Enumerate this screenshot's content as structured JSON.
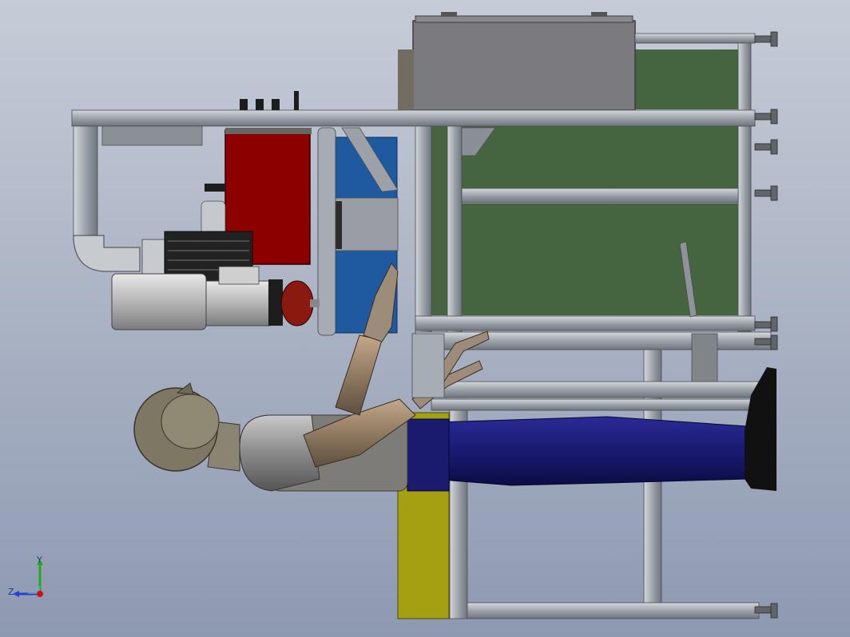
{
  "viewport": {
    "background_top": "#c6ccd7",
    "background_bottom": "#8e99b1"
  },
  "triad": {
    "x_label": "",
    "y_label": "Y",
    "z_label": "Z",
    "colors": {
      "x": "#cc1111",
      "y": "#22aa22",
      "z": "#2244cc"
    }
  },
  "parts": {
    "frame_color": "#a7adb4",
    "panel_color": "#44653f",
    "control_box_color": "#8d0000",
    "blue_panel_color": "#1f5aa0",
    "base_plate_color": "#a3a112",
    "cover_color": "#7b7b7f",
    "legs_color": "#1a1a72",
    "torso_color": "#7e7c78",
    "head_color": "#7d7764",
    "arm_color": "#907a62",
    "motor_color": "#b5b5b5"
  }
}
